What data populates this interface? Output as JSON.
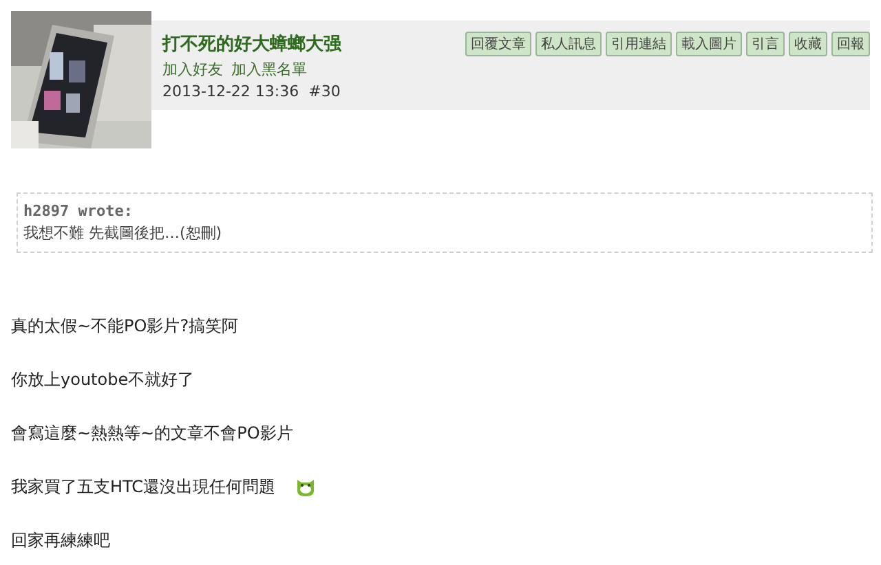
{
  "post": {
    "author": "打不死的好大蟑螂大强",
    "links": [
      "加入好友",
      "加入黑名單"
    ],
    "date": "2013-12-22 13:36",
    "number": "#30",
    "buttons": [
      "回覆文章",
      "私人訊息",
      "引用連結",
      "載入圖片",
      "引言",
      "收藏",
      "回報"
    ],
    "quote": {
      "author": "h2897 wrote:",
      "text": "我想不難 先截圖後把…(恕刪)"
    },
    "lines": [
      {
        "text": "真的太假~不能PO影片?搞笑阿",
        "emoticon": false
      },
      {
        "text": "你放上youtobe不就好了",
        "emoticon": false
      },
      {
        "text": "會寫這麼~熱熱等~的文章不會PO影片",
        "emoticon": false
      },
      {
        "text": "我家買了五支HTC還沒出現任何問題",
        "emoticon": true
      },
      {
        "text": "回家再練練吧",
        "emoticon": false
      }
    ]
  }
}
